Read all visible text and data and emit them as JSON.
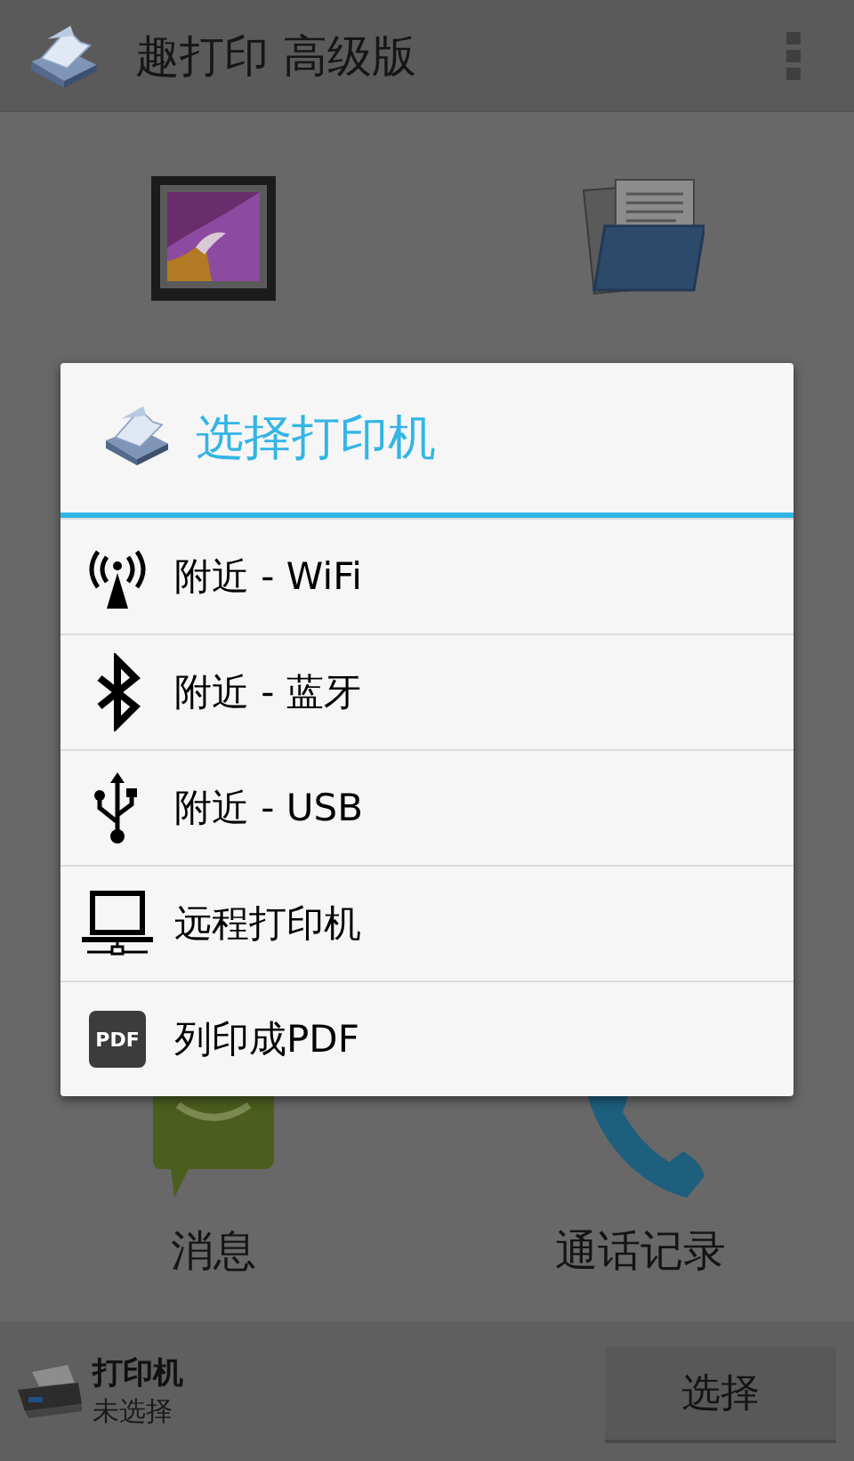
{
  "app_bar": {
    "title": "趣打印 高级版"
  },
  "grid": [
    {
      "kind": "picture"
    },
    {
      "kind": "folder"
    },
    {
      "kind": "message",
      "label": "消息"
    },
    {
      "kind": "phone",
      "label": "通话记录"
    }
  ],
  "printer_bar": {
    "title": "打印机",
    "status": "未选择",
    "button": "选择"
  },
  "dialog": {
    "title": "选择打印机",
    "items": [
      {
        "kind": "wifi",
        "label": "附近 - WiFi"
      },
      {
        "kind": "bluetooth",
        "label": "附近 - 蓝牙"
      },
      {
        "kind": "usb",
        "label": "附近 - USB"
      },
      {
        "kind": "computer",
        "label": "远程打印机"
      },
      {
        "kind": "pdf",
        "label": "列印成PDF",
        "icon_text": "PDF"
      }
    ]
  }
}
